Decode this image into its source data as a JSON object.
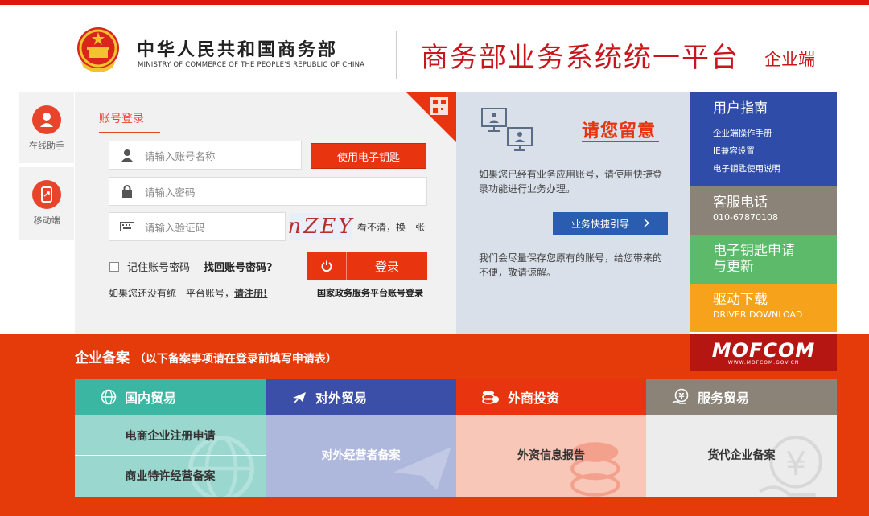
{
  "header": {
    "ministry_cn": "中华人民共和国商务部",
    "ministry_en": "MINISTRY OF COMMERCE OF THE PEOPLE'S REPUBLIC OF CHINA",
    "platform_title": "商务部业务系统统一平台",
    "platform_sub": "企业端"
  },
  "helpers": {
    "online": "在线助手",
    "mobile": "移动端"
  },
  "login": {
    "tab": "账号登录",
    "username_placeholder": "请输入账号名称",
    "password_placeholder": "请输入密码",
    "captcha_placeholder": "请输入验证码",
    "ekey_button": "使用电子钥匙",
    "captcha_text": "nZEY",
    "refresh": "看不清，换一张",
    "remember": "记住账号密码",
    "forgot": "找回账号密码?",
    "login_button": "登录",
    "no_account": "如果您还没有统一平台账号，",
    "register": "请注册!",
    "gov_login": "国家政务服务平台账号登录"
  },
  "notice": {
    "title": "请您留意",
    "p1": "如果您已经有业务应用账号，请使用快捷登录功能进行业务办理。",
    "button": "业务快捷引导",
    "p2": "我们会尽量保存您原有的账号，给您带来的不便，敬请谅解。"
  },
  "right": {
    "guide_title": "用户指南",
    "guide_links": [
      "企业端操作手册",
      "IE兼容设置",
      "电子钥匙使用说明"
    ],
    "hotline_title": "客服电话",
    "hotline_number": "010-67870108",
    "ekey_title_1": "电子钥匙申请",
    "ekey_title_2": "与更新",
    "driver_title": "驱动下载",
    "driver_en": "DRIVER DOWNLOAD"
  },
  "bottom": {
    "title": "企业备案",
    "subtitle": "（以下备案事项请在登录前填写申请表）",
    "mofcom": "MOFCOM",
    "mofcom_url": "WWW.MOFCOM.GOV.CN",
    "categories": [
      {
        "title": "国内贸易",
        "links": [
          "电商企业注册申请",
          "商业特许经营备案"
        ]
      },
      {
        "title": "对外贸易",
        "links": [
          "对外经营者备案"
        ]
      },
      {
        "title": "外商投资",
        "links": [
          "外资信息报告"
        ]
      },
      {
        "title": "服务贸易",
        "links": [
          "货代企业备案"
        ]
      }
    ]
  },
  "colors": {
    "brand_red": "#e53a0a",
    "title_red": "#c8161d",
    "guide_blue": "#2f4ca8",
    "hotline_gray": "#8b8377",
    "ekey_green": "#5dba6a",
    "driver_orange": "#f7a21b"
  }
}
